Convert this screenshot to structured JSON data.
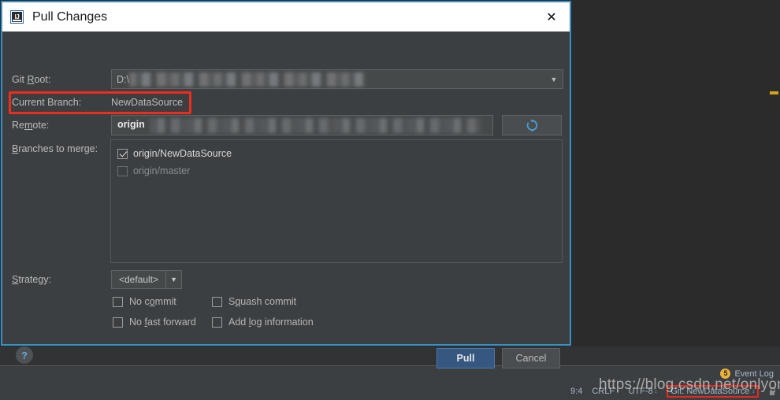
{
  "dialog": {
    "title": "Pull Changes",
    "app_icon": "intellij-idea-icon",
    "close_icon": "✕",
    "fields": {
      "git_root_label": "Git Root:",
      "git_root_value": "D:\\",
      "current_branch_label": "Current Branch:",
      "current_branch_value": "NewDataSource",
      "remote_label": "Remote:",
      "remote_value": "origin",
      "refresh_icon": "refresh-icon",
      "branches_label": "Branches to merge:",
      "strategy_label": "Strategy:",
      "strategy_value": "<default>",
      "strategy_arrow": "▼",
      "combo_arrow": "▼"
    },
    "branches": [
      {
        "label": "origin/NewDataSource",
        "checked": true,
        "enabled": true
      },
      {
        "label": "origin/master",
        "checked": false,
        "enabled": false
      }
    ],
    "options": [
      {
        "label": "No commit",
        "checked": false
      },
      {
        "label": "Squash commit",
        "checked": false
      },
      {
        "label": "No fast forward",
        "checked": false
      },
      {
        "label": "Add log information",
        "checked": false
      }
    ],
    "footer": {
      "help_label": "?",
      "pull_label": "Pull",
      "cancel_label": "Cancel"
    },
    "annotation_color": "#ef2d1c",
    "border_color": "#3592c4"
  },
  "ide": {
    "event_log": {
      "count": "5",
      "label": "Event Log"
    },
    "status": {
      "caret_position": "9:4",
      "line_separator": "CRLF",
      "encoding": "UTF-8",
      "git_branch": "Git: NewDataSource",
      "caret_glyph": "↕",
      "lock_icon": "lock-icon"
    },
    "watermark": "https://blog.csdn.net/onlyone"
  }
}
